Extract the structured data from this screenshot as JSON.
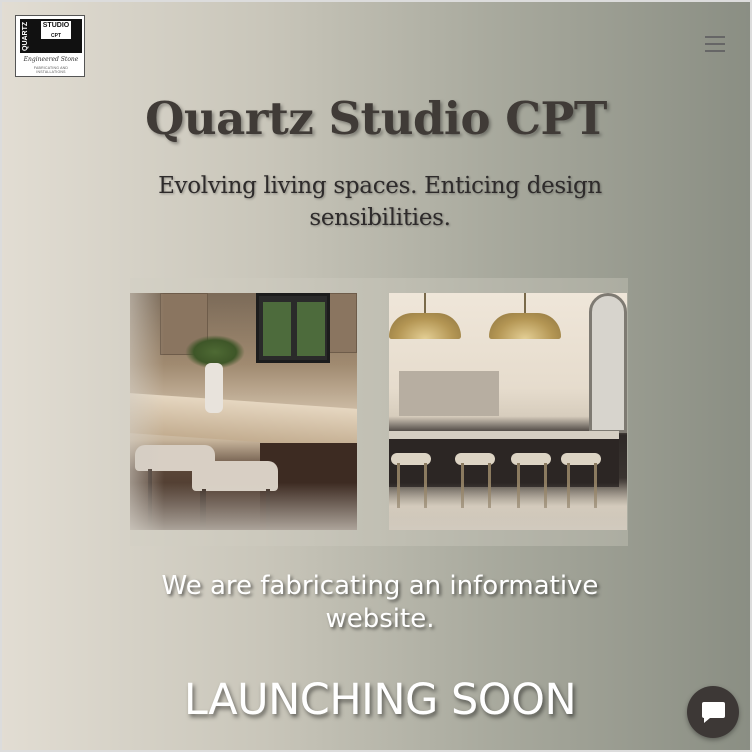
{
  "logo": {
    "vertical_text": "QUARTZ",
    "box_text": "STUDIO",
    "box_sub": "CPT",
    "script_text": "Engineered Stone",
    "tagline": "FABRICATING AND INSTALLATIONS"
  },
  "header": {
    "title": "Quartz Studio CPT",
    "subtitle": "Evolving living spaces. Enticing design sensibilities."
  },
  "main": {
    "info_text": "We are fabricating an informative website.",
    "launch_text": "LAUNCHING SOON"
  },
  "icons": {
    "menu": "hamburger-menu-icon",
    "chat": "chat-bubble-icon"
  },
  "colors": {
    "title": "#403b37",
    "chat_button": "#3d3836"
  }
}
